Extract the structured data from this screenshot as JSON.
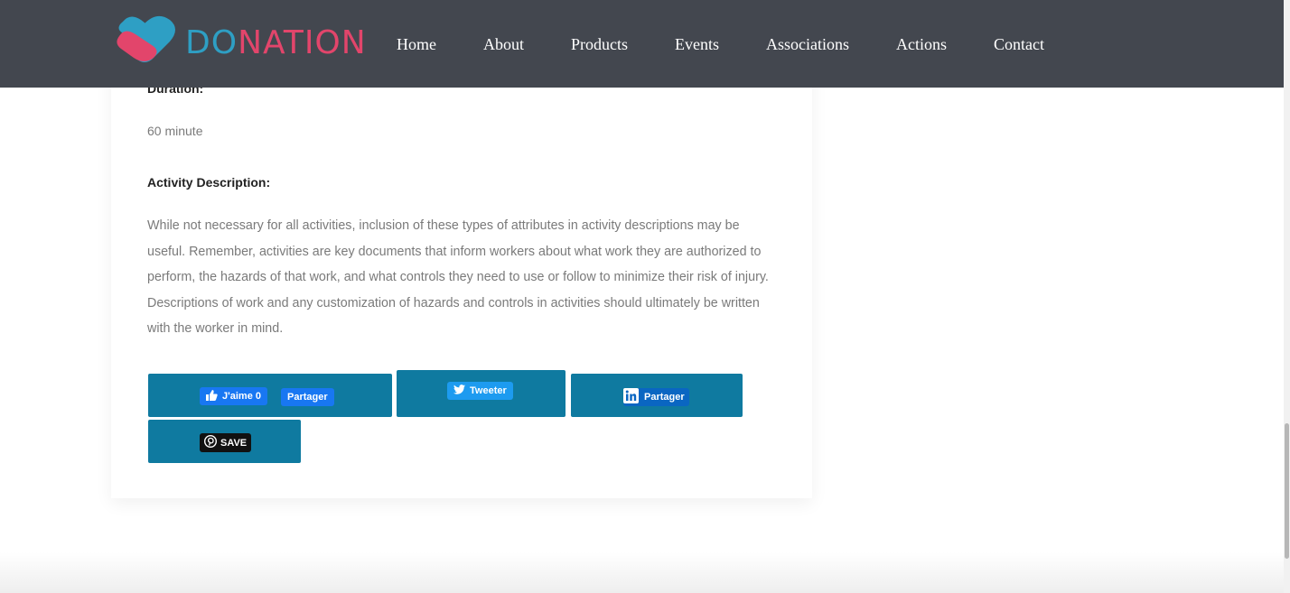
{
  "brand": {
    "logo_part_a": "DO",
    "logo_part_b": "NATION",
    "accent_blue": "#2e9fc4",
    "accent_pink": "#e2456b",
    "logo_icon": "heart-icon"
  },
  "nav": {
    "items": [
      "Home",
      "About",
      "Products",
      "Events",
      "Associations",
      "Actions",
      "Contact"
    ]
  },
  "activity": {
    "duration_label": "Duration:",
    "duration_value": "60 minute",
    "description_label": "Activity Description:",
    "description_text": "While not necessary for all activities, inclusion of these types of attributes in activity descriptions may be useful. Remember, activities are key documents that inform workers about what work they are authorized to perform, the hazards of that work, and what controls they need to use or follow to minimize their risk of injury. Descriptions of work and any customization of hazards and controls in activities should ultimately be written with the worker in mind."
  },
  "share": {
    "facebook_like": "J'aime 0",
    "facebook_share": "Partager",
    "twitter": "Tweeter",
    "linkedin": "Partager",
    "pinterest": "SAVE",
    "button_color": "#0f7aa0"
  }
}
